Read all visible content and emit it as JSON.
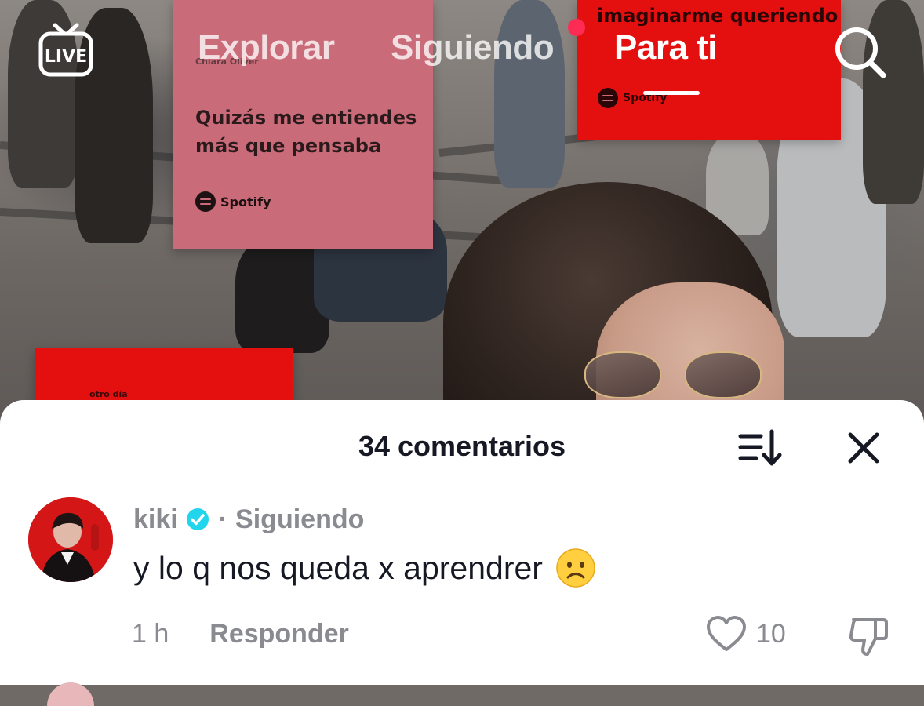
{
  "nav": {
    "live_label": "LIVE",
    "tabs": [
      {
        "label": "Explorar",
        "active": false
      },
      {
        "label": "Siguiendo",
        "active": false,
        "has_notification": true
      },
      {
        "label": "Para ti",
        "active": true
      }
    ]
  },
  "video": {
    "pink_poster": {
      "artist": "Chiara Oliver",
      "quote": "Quizás me entiendes más que pensaba",
      "brand": "Spotify"
    },
    "red_poster": {
      "quote_line1": "imaginarme queriendo",
      "brand": "Spotify"
    },
    "red_poster_bottom": {
      "text": "otro día"
    }
  },
  "comments_sheet": {
    "title": "34 comentarios",
    "comments": [
      {
        "username": "kiki",
        "verified": true,
        "relation": "Siguiendo",
        "text": "y lo q nos queda x aprendrer",
        "emoji": "frowning-face",
        "time": "1 h",
        "reply_label": "Responder",
        "likes": "10"
      }
    ]
  },
  "colors": {
    "accent_red": "#fe2c55",
    "verified_blue": "#20d5ec",
    "text_primary": "#161823",
    "text_secondary": "#8a8b91"
  }
}
